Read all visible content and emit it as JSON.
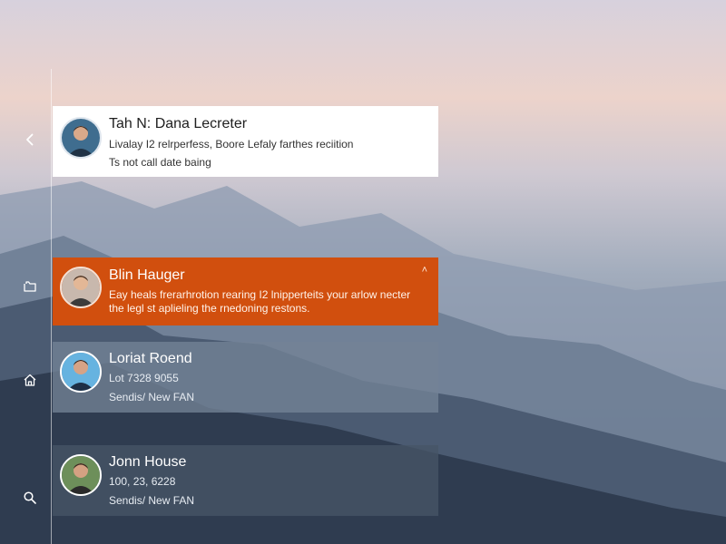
{
  "colors": {
    "accent": "#d14f0e",
    "card_white": "#ffffff",
    "card_slate": "#738396",
    "card_dark": "#465466"
  },
  "rail": {
    "items": [
      {
        "icon": "chevron-left-icon"
      },
      {
        "icon": "folder-icon"
      },
      {
        "icon": "home-icon"
      },
      {
        "icon": "search-icon"
      }
    ]
  },
  "cards": [
    {
      "name": "Tah N: Dana Lecreter",
      "line1": "Livalay I2 relrperfess, Boore Lefaly farthes reciition",
      "line2": "Ts not call date baing",
      "avatar": "avatar-icon"
    },
    {
      "name": "Blin Hauger",
      "line1": "Eay heals frerarhrotion rearing I2 lnipperteits your arlow necter",
      "line2": "the legl st aplieling the rnedoning restons.",
      "close": "˄",
      "avatar": "avatar-icon"
    },
    {
      "name": "Loriat Roend",
      "line1": "Lot 7328 9055",
      "line2": "Sendis/ New FAN",
      "avatar": "avatar-icon"
    },
    {
      "name": "Jonn House",
      "line1": "100, 23, 6228",
      "line2": "Sendis/ New FAN",
      "avatar": "avatar-icon"
    }
  ]
}
